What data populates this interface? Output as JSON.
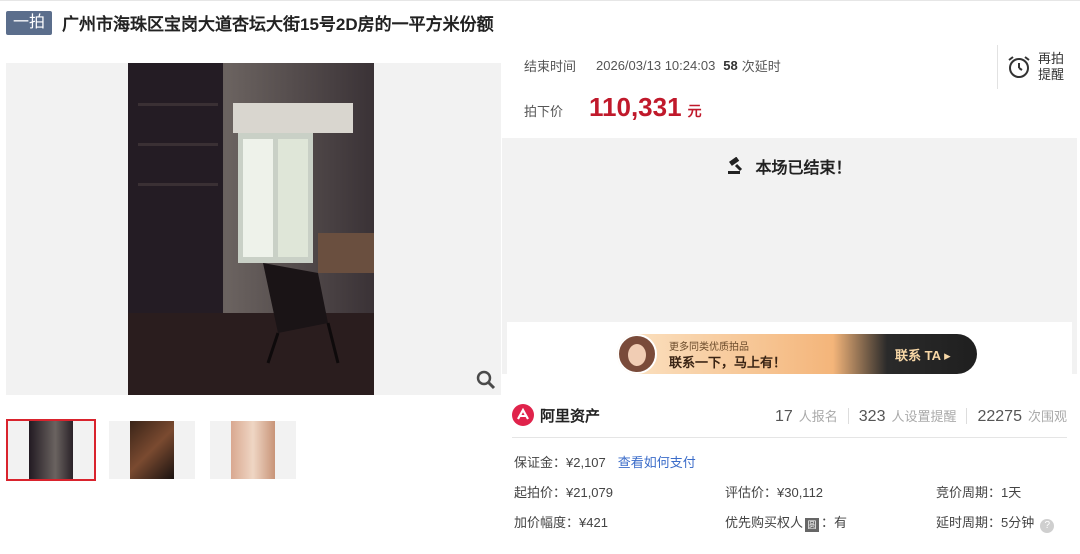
{
  "title": {
    "tag": "一拍",
    "text": "广州市海珠区宝岗大道杏坛大街15号2D房的一平方米份额"
  },
  "auction": {
    "end_label": "结束时间",
    "end_time": "2026/03/13 10:24:03",
    "delay_count": "58",
    "delay_label": "次延时",
    "price_label": "拍下价",
    "price": "110,331",
    "price_unit": "元",
    "remind_label_1": "再拍",
    "remind_label_2": "提醒",
    "ended_message": "本场已结束！"
  },
  "banner": {
    "line1": "更多同类优质拍品",
    "line2": "联系一下，马上有！",
    "cta": "联系 TA ▸"
  },
  "stats": {
    "brand": "阿里资产",
    "signups": "17",
    "signups_label": "人报名",
    "reminders": "323",
    "reminders_label": "人设置提醒",
    "views": "22275",
    "views_label": "次围观"
  },
  "details": {
    "deposit": "保证金：¥2,107",
    "deposit_link": "查看如何支付",
    "start_price": "起拍价：¥21,079",
    "appraisal": "评估价：¥30,112",
    "bid_period": "竞价周期：1天",
    "increment": "加价幅度：¥421",
    "priority_label": "优先购买权人",
    "priority_badge": "圆",
    "priority_value": "：有",
    "delay_period": "延时周期：5分钟"
  },
  "icons": [
    "alarm-clock-icon",
    "gavel-icon",
    "zoom-icon",
    "help-icon",
    "brand-logo-icon"
  ],
  "colors": {
    "price": "#c0192b",
    "link": "#3b6cc9",
    "tag": "#5b6e8c",
    "selected": "#d9232d"
  }
}
